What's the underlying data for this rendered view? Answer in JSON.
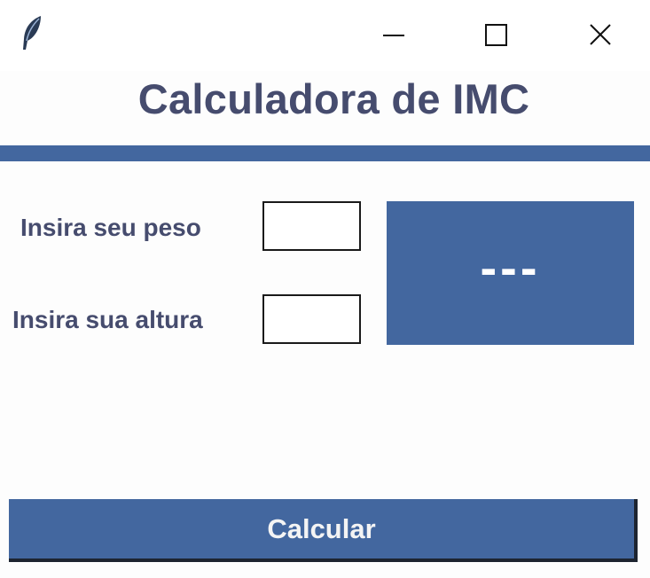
{
  "window": {
    "controls": [
      {
        "name": "minimize",
        "icon": "minimize-icon"
      },
      {
        "name": "maximize",
        "icon": "maximize-icon"
      },
      {
        "name": "close",
        "icon": "close-icon"
      }
    ],
    "app_icon": "feather-icon"
  },
  "header": {
    "title": "Calculadora de IMC"
  },
  "form": {
    "weight_label": "Insira seu peso",
    "weight_value": "",
    "height_label": "Insira sua altura",
    "height_value": ""
  },
  "result": {
    "text": "---"
  },
  "actions": {
    "calculate_label": "Calcular"
  },
  "colors": {
    "accent": "#43679f",
    "text": "#464c6e",
    "background": "#fdfdfd",
    "button_text": "#f4f4f4"
  }
}
